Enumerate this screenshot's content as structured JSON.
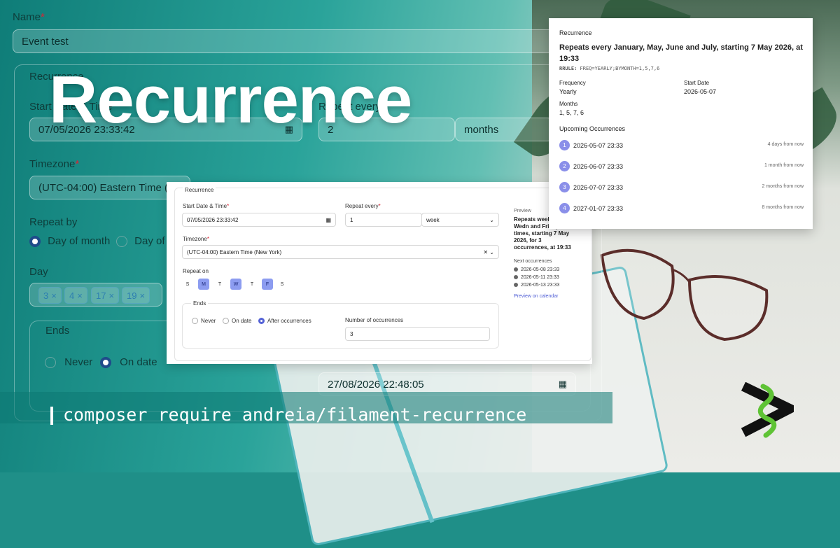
{
  "base": {
    "name_label": "Name",
    "name_value": "Event test",
    "section_label": "Recurrence",
    "start_label": "Start Date & Time",
    "start_value": "07/05/2026 23:33:42",
    "repeat_every_label": "Repeat every",
    "repeat_every_value": "2",
    "repeat_every_unit": "months",
    "timezone_label": "Timezone",
    "timezone_value": "(UTC-04:00) Eastern Time (N",
    "repeat_by_label": "Repeat by",
    "repeat_by_options": [
      "Day of month",
      "Day of"
    ],
    "day_label": "Day",
    "day_pills": [
      "3",
      "4",
      "17",
      "19"
    ],
    "ends_label": "Ends",
    "ends_options": [
      "Never",
      "On date"
    ],
    "end_date_value": "27/08/2026 22:48:05"
  },
  "hero_title": "Recurrence",
  "command": "composer require andreia/filament-recurrence",
  "mid": {
    "section_label": "Recurrence",
    "start_label": "Start Date & Time",
    "start_value": "07/05/2026 23:33:42",
    "repeat_every_label": "Repeat every",
    "repeat_every_value": "1",
    "repeat_every_unit": "week",
    "timezone_label": "Timezone",
    "timezone_value": "(UTC-04:00) Eastern Time (New York)",
    "repeat_on_label": "Repeat on",
    "days": [
      {
        "label": "S",
        "on": false
      },
      {
        "label": "M",
        "on": true
      },
      {
        "label": "T",
        "on": false
      },
      {
        "label": "W",
        "on": true
      },
      {
        "label": "T",
        "on": false
      },
      {
        "label": "F",
        "on": true
      },
      {
        "label": "S",
        "on": false
      }
    ],
    "ends_label": "Ends",
    "ends_options": [
      "Never",
      "On date",
      "After occurrences"
    ],
    "num_occ_label": "Number of occurrences",
    "num_occ_value": "3",
    "preview_label": "Preview",
    "preview_text": "Repeats week Monday, Wedn and Friday for 3 times, starting 7 May 2026, for 3 occurrences, at 19:33",
    "next_label": "Next occurrences",
    "next_items": [
      "2026-05-08 23:33",
      "2026-05-11 23:33",
      "2026-05-13 23:33"
    ],
    "calendar_link": "Preview on calendar"
  },
  "tr": {
    "section_label": "Recurrence",
    "headline_l1": "Repeats every January, May, June and July, starting 7 May 2026, at",
    "headline_l2": "19:33",
    "rrule_label": "RRULE:",
    "rrule_value": "FREQ=YEARLY;BYMONTH=1,5,7,6",
    "frequency_label": "Frequency",
    "frequency_value": "Yearly",
    "start_label": "Start Date",
    "start_value": "2026-05-07",
    "months_label": "Months",
    "months_value": "1, 5, 7, 6",
    "upcoming_label": "Upcoming Occurrences",
    "upcoming": [
      {
        "n": "1",
        "date": "2026-05-07 23:33",
        "rel": "4 days from now"
      },
      {
        "n": "2",
        "date": "2026-06-07 23:33",
        "rel": "1 month from now"
      },
      {
        "n": "3",
        "date": "2026-07-07 23:33",
        "rel": "2 months from now"
      },
      {
        "n": "4",
        "date": "2027-01-07 23:33",
        "rel": "8 months from now"
      }
    ]
  },
  "colors": {
    "accent": "#8c9cf0",
    "teal": "#1f8f88"
  }
}
